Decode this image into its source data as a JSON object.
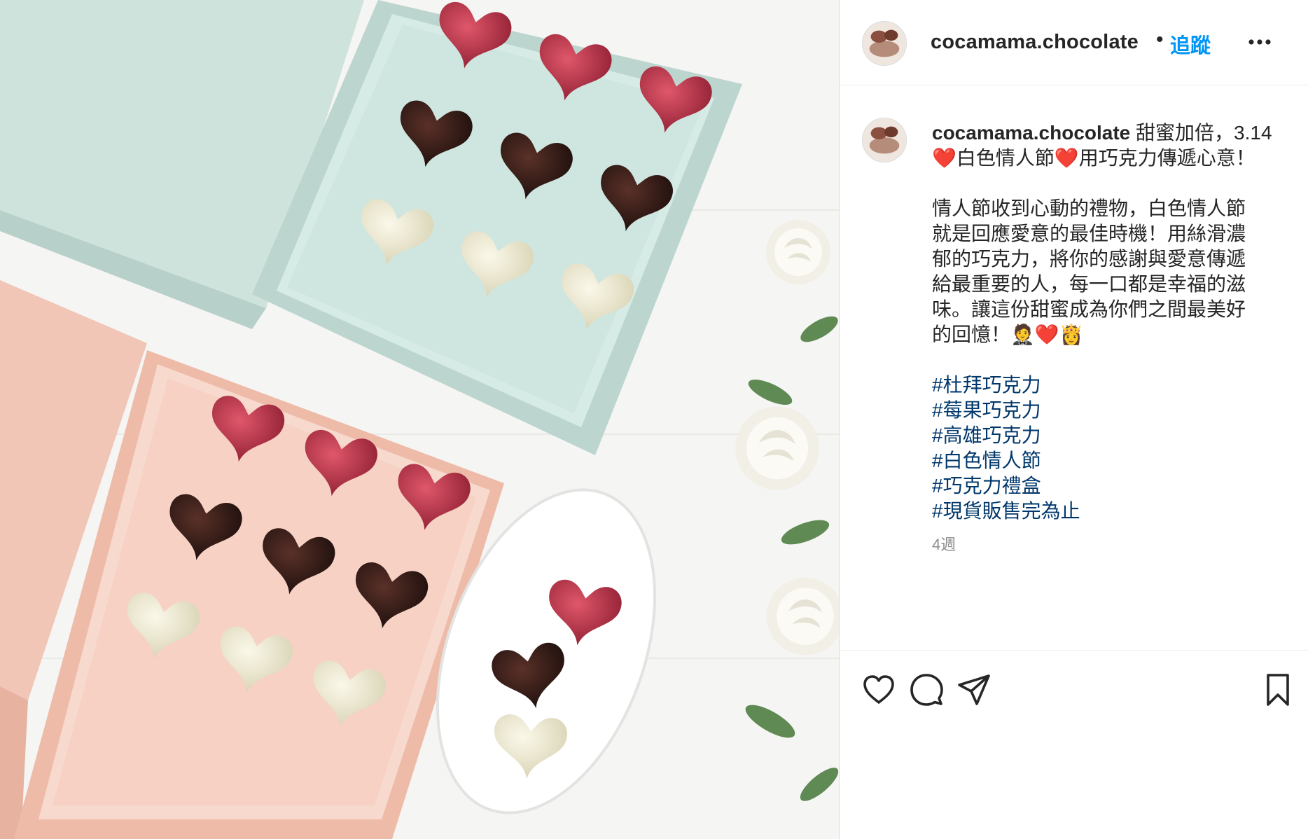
{
  "post": {
    "username": "cocamama.chocolate",
    "separator": "•",
    "follow_label": "追蹤",
    "more_icon": "more-horizontal-icon"
  },
  "caption": {
    "username": "cocamama.chocolate",
    "line1": " 甜蜜加倍，3.14",
    "line2": "❤️白色情人節❤️用巧克力傳遞心意！",
    "paragraph": [
      "情人節收到心動的禮物，白色情人節",
      "就是回應愛意的最佳時機！用絲滑濃",
      "郁的巧克力，將你的感謝與愛意傳遞",
      "給最重要的人，每一口都是幸福的滋",
      "味。讓這份甜蜜成為你們之間最美好",
      "的回憶！🤵❤️👸"
    ],
    "hashtags": [
      "#杜拜巧克力",
      "#莓果巧克力",
      "#高雄巧克力",
      "#白色情人節",
      "#巧克力禮盒",
      "#現貨販售完為止"
    ]
  },
  "timestamp": "4週",
  "actions": {
    "like_icon": "heart-icon",
    "comment_icon": "comment-icon",
    "share_icon": "send-icon",
    "save_icon": "bookmark-icon"
  },
  "colors": {
    "follow_blue": "#0095f6",
    "hashtag_blue": "#00376b",
    "timestamp_gray": "#8e8e8e",
    "text": "#262626"
  }
}
